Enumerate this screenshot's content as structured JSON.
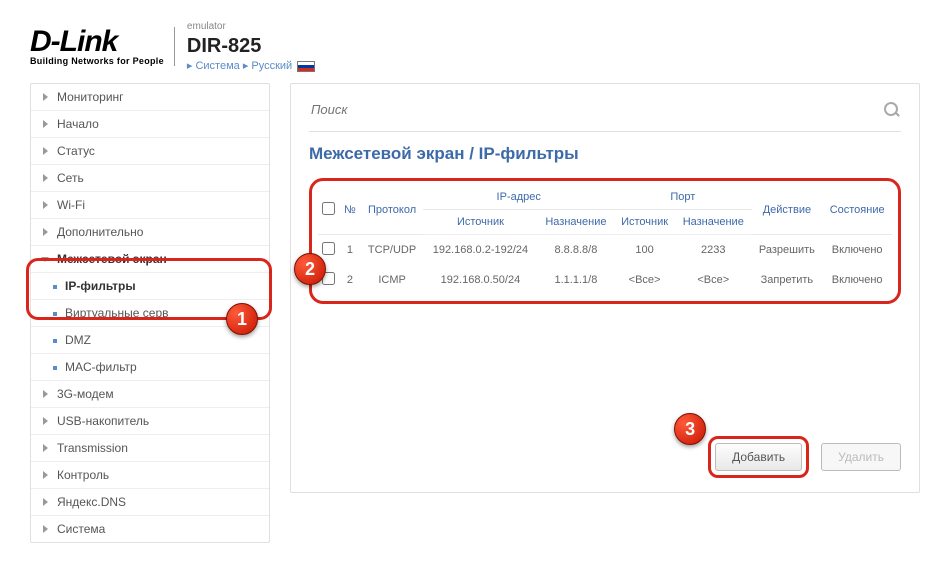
{
  "brand": {
    "name": "D-Link",
    "tagline": "Building Networks for People"
  },
  "device": {
    "emu": "emulator",
    "model": "DIR-825",
    "crumb_system": "Система",
    "crumb_lang": "Русский"
  },
  "sidebar": {
    "items": [
      {
        "label": "Мониторинг"
      },
      {
        "label": "Начало"
      },
      {
        "label": "Статус"
      },
      {
        "label": "Сеть"
      },
      {
        "label": "Wi-Fi"
      },
      {
        "label": "Дополнительно"
      },
      {
        "label": "Межсетевой экран"
      },
      {
        "label": "IP-фильтры"
      },
      {
        "label": "Виртуальные серв"
      },
      {
        "label": "DMZ"
      },
      {
        "label": "MAC-фильтр"
      },
      {
        "label": "3G-модем"
      },
      {
        "label": "USB-накопитель"
      },
      {
        "label": "Transmission"
      },
      {
        "label": "Контроль"
      },
      {
        "label": "Яндекс.DNS"
      },
      {
        "label": "Система"
      }
    ]
  },
  "search": {
    "placeholder": "Поиск"
  },
  "page_title": "Межсетевой экран /  IP-фильтры",
  "table": {
    "group_ip": "IP-адрес",
    "group_port": "Порт",
    "h_no": "№",
    "h_proto": "Протокол",
    "h_src": "Источник",
    "h_dst": "Назначение",
    "h_psrc": "Источник",
    "h_pdst": "Назначение",
    "h_action": "Действие",
    "h_state": "Состояние",
    "rows": [
      {
        "no": "1",
        "proto": "TCP/UDP",
        "src": "192.168.0.2-192/24",
        "dst": "8.8.8.8/8",
        "psrc": "100",
        "pdst": "2233",
        "action": "Разрешить",
        "state": "Включено"
      },
      {
        "no": "2",
        "proto": "ICMP",
        "src": "192.168.0.50/24",
        "dst": "1.1.1.1/8",
        "psrc": "<Все>",
        "pdst": "<Все>",
        "action": "Запретить",
        "state": "Включено"
      }
    ]
  },
  "buttons": {
    "add": "Добавить",
    "del": "Удалить"
  },
  "annot": {
    "b1": "1",
    "b2": "2",
    "b3": "3"
  }
}
